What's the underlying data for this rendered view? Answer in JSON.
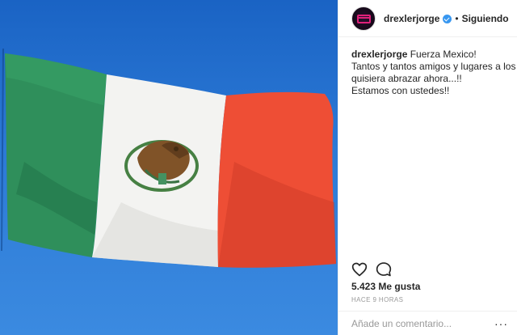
{
  "post": {
    "author": "drexlerjorge",
    "follow_separator": "•",
    "follow_status": "Siguiendo",
    "caption_lines": [
      "Fuerza Mexico!",
      "Tantos y tantos amigos y lugares a los que",
      "quisiera abrazar ahora...!!",
      "Estamos con ustedes!!"
    ],
    "likes": "5.423 Me gusta",
    "timestamp": "HACE 9 HORAS",
    "comment_placeholder": "Añade un comentario...",
    "more_glyph": "···"
  },
  "icons": {
    "like": "heart-icon",
    "comment": "comment-icon",
    "verified": "verified-badge-icon",
    "more": "more-options-icon"
  },
  "colors": {
    "sky": "#2c7ad6",
    "flag_green": "#2e8b57",
    "flag_white": "#f4f4f2",
    "flag_red": "#ef4d34",
    "verified_blue": "#3897f0"
  }
}
